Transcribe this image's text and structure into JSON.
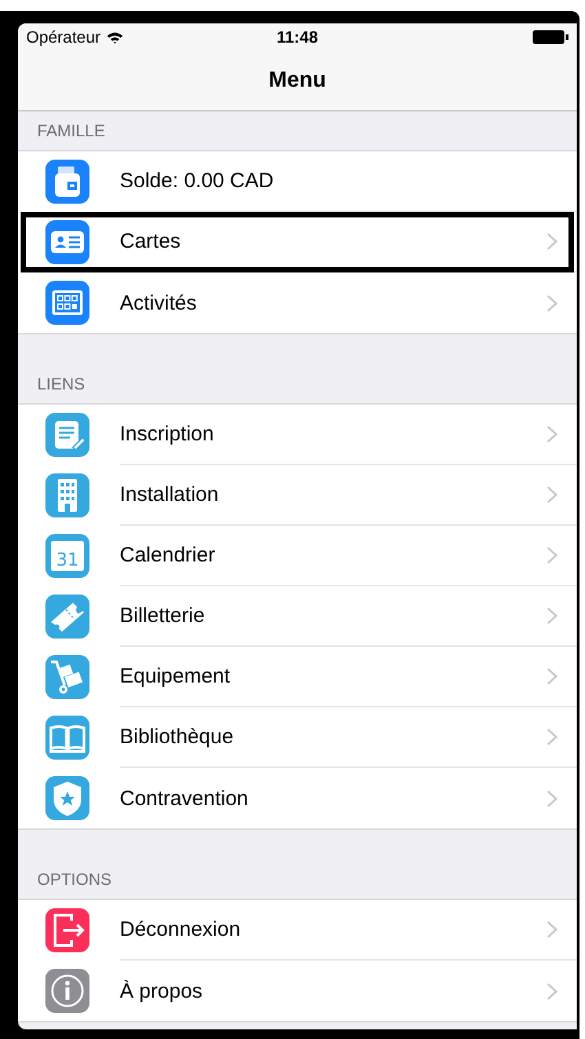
{
  "status_bar": {
    "carrier": "Opérateur",
    "time": "11:48"
  },
  "nav_bar": {
    "title": "Menu"
  },
  "sections": [
    {
      "header": "FAMILLE",
      "items": [
        {
          "label": "Solde: 0.00 CAD",
          "kind": "wallet",
          "color": "#1a82fb",
          "chevron": false,
          "highlighted": false
        },
        {
          "label": "Cartes",
          "kind": "card",
          "color": "#1a82fb",
          "chevron": true,
          "highlighted": true
        },
        {
          "label": "Activités",
          "kind": "grid",
          "color": "#1a82fb",
          "chevron": true,
          "highlighted": false
        }
      ]
    },
    {
      "header": "LIENS",
      "items": [
        {
          "label": "Inscription",
          "kind": "form",
          "color": "#34a8df",
          "chevron": true,
          "highlighted": false
        },
        {
          "label": "Installation",
          "kind": "building",
          "color": "#34a8df",
          "chevron": true,
          "highlighted": false
        },
        {
          "label": "Calendrier",
          "kind": "calendar",
          "color": "#34a8df",
          "chevron": true,
          "highlighted": false,
          "icon_text": "31"
        },
        {
          "label": "Billetterie",
          "kind": "ticket",
          "color": "#34a8df",
          "chevron": true,
          "highlighted": false
        },
        {
          "label": "Equipement",
          "kind": "trolley",
          "color": "#34a8df",
          "chevron": true,
          "highlighted": false
        },
        {
          "label": "Bibliothèque",
          "kind": "book",
          "color": "#34a8df",
          "chevron": true,
          "highlighted": false
        },
        {
          "label": "Contravention",
          "kind": "badge",
          "color": "#34a8df",
          "chevron": true,
          "highlighted": false
        }
      ]
    },
    {
      "header": "OPTIONS",
      "items": [
        {
          "label": "Déconnexion",
          "kind": "exit",
          "color": "#fc2f5b",
          "chevron": true,
          "highlighted": false
        },
        {
          "label": "À propos",
          "kind": "info",
          "color": "#8e8e93",
          "chevron": true,
          "highlighted": false
        }
      ]
    }
  ]
}
